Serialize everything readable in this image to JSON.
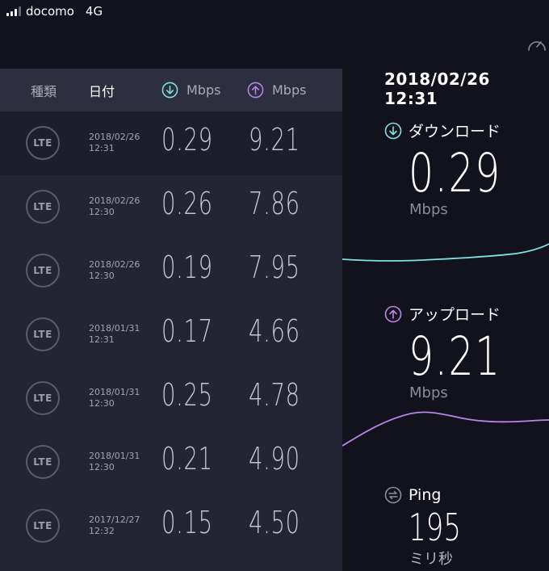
{
  "status_bar": {
    "carrier": "docomo",
    "network": "4G"
  },
  "table": {
    "headers": {
      "type": "種類",
      "date": "日付",
      "download_unit": "Mbps",
      "upload_unit": "Mbps"
    },
    "rows": [
      {
        "badge": "LTE",
        "date": "2018/02/26",
        "time": "12:31",
        "download": "0.29",
        "upload": "9.21",
        "active": true
      },
      {
        "badge": "LTE",
        "date": "2018/02/26",
        "time": "12:30",
        "download": "0.26",
        "upload": "7.86",
        "active": false
      },
      {
        "badge": "LTE",
        "date": "2018/02/26",
        "time": "12:30",
        "download": "0.19",
        "upload": "7.95",
        "active": false
      },
      {
        "badge": "LTE",
        "date": "2018/01/31",
        "time": "12:31",
        "download": "0.17",
        "upload": "4.66",
        "active": false
      },
      {
        "badge": "LTE",
        "date": "2018/01/31",
        "time": "12:30",
        "download": "0.25",
        "upload": "4.78",
        "active": false
      },
      {
        "badge": "LTE",
        "date": "2018/01/31",
        "time": "12:30",
        "download": "0.21",
        "upload": "4.90",
        "active": false
      },
      {
        "badge": "LTE",
        "date": "2017/12/27",
        "time": "12:32",
        "download": "0.15",
        "upload": "4.50",
        "active": false
      }
    ]
  },
  "detail": {
    "datetime": "2018/02/26 12:31",
    "download": {
      "label": "ダウンロード",
      "value": "0.29",
      "unit": "Mbps"
    },
    "upload": {
      "label": "アップロード",
      "value": "9.21",
      "unit": "Mbps"
    },
    "ping": {
      "label": "Ping",
      "value": "195",
      "unit": "ミリ秒"
    }
  },
  "colors": {
    "download_accent": "#7fe3e4",
    "upload_accent": "#b985e9",
    "background": "#12121c",
    "panel": "#232434"
  },
  "icons": {
    "download": "arrow-down-circle-icon",
    "upload": "arrow-up-circle-icon",
    "ping": "ping-exchange-icon",
    "gauge": "speedometer-icon"
  }
}
